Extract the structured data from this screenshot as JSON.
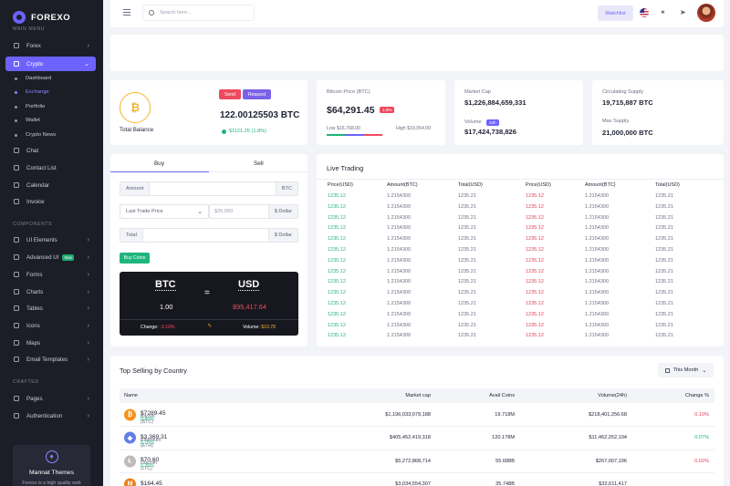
{
  "brand": "FOREXO",
  "sidebar": {
    "main_menu": "MAIN MENU",
    "components": "COMPONENTS",
    "crafted": "CRAFTED",
    "items": [
      {
        "label": "Forex"
      },
      {
        "label": "Crypto"
      },
      {
        "label": "Chat"
      },
      {
        "label": "Contact List"
      },
      {
        "label": "Calendar"
      },
      {
        "label": "Invoice"
      },
      {
        "label": "UI Elements"
      },
      {
        "label": "Advanced UI"
      },
      {
        "label": "Forms"
      },
      {
        "label": "Charts"
      },
      {
        "label": "Tables"
      },
      {
        "label": "Icons"
      },
      {
        "label": "Maps"
      },
      {
        "label": "Email Templates"
      },
      {
        "label": "Pages"
      },
      {
        "label": "Authentication"
      }
    ],
    "crypto_sub": [
      "Dashboard",
      "Exchange",
      "Portfolio",
      "Wallet",
      "Crypto News"
    ],
    "new_badge": "New",
    "promo_title": "Mannat Themes",
    "promo_desc": "Forexo is a high quality web"
  },
  "topbar": {
    "search_placeholder": "Search here...",
    "watchlist": "Watchlist"
  },
  "balance": {
    "coin": "₿",
    "label": "Total Balance",
    "send": "Send",
    "request": "Request",
    "amount": "122.00125503 BTC",
    "usd": "$1121.25 (1.8%)"
  },
  "btc_price": {
    "label": "Bitcoin Price (BTC)",
    "value": "$64,291.45",
    "change": "1.8%",
    "low": "Low $16,768.00",
    "high": "High $19,054.00"
  },
  "market": {
    "cap_label": "Market Cap",
    "cap": "$1,226,884,659,331",
    "volume_label": "Volume",
    "volume_badge": "24h",
    "volume": "$17,424,738,826"
  },
  "supply": {
    "circ_label": "Circulating Supply",
    "circ": "19,715,887 BTC",
    "max_label": "Max Supply",
    "max": "21,000,000 BTC"
  },
  "trade": {
    "tab_buy": "Buy",
    "tab_sell": "Sell",
    "amount_label": "Amount",
    "amount_unit": "BTC",
    "order_type": "Last Trade Price",
    "price_placeholder": "$25,000",
    "price_unit": "$ Dollar",
    "total_label": "Total",
    "total_unit": "$ Dollar",
    "buy_button": "Buy Coins",
    "from": "BTC",
    "to": "USD",
    "from_val": "1.00",
    "to_val": "$95,417.64",
    "change_label": "Change:",
    "change": "-3.19%",
    "volume_label": "Volume:",
    "volume": "$10.78"
  },
  "live": {
    "title": "Live Trading",
    "headers": [
      "Price(USD)",
      "Amount(BTC)",
      "Total(USD)",
      "Price(USD)",
      "Amount(BTC)",
      "Total(USD)"
    ],
    "price": "1235.12",
    "amount": "1.2154300",
    "total": "1235.21"
  },
  "top": {
    "title": "Top Selling by Country",
    "filter": "This Month",
    "headers": [
      "Name",
      "Market cap",
      "Avail Coins",
      "Volume(24h)",
      "Change %"
    ],
    "rows": [
      {
        "price": "$7289.45",
        "name": "Bitcoin (BTC)",
        "pct": "0.45%",
        "cap": "$1,196,033,079,188",
        "coins": "19.718M",
        "vol": "$218,401,256.68",
        "change": "0.10%",
        "color": "#f7931a",
        "sym": "₿"
      },
      {
        "price": "$3,369.31",
        "name": "Ethereum (ETH)",
        "pct": "0.75%",
        "cap": "$405,452,419,318",
        "coins": "120.178M",
        "vol": "$11,462,252,104",
        "change": "0.07%",
        "color": "#627eea",
        "sym": "◆"
      },
      {
        "price": "$70.60",
        "name": "Litecoin (LTC)",
        "pct": "0.35%",
        "cap": "$5,272,868,714",
        "coins": "55.688B",
        "vol": "$267,007,196",
        "change": "0.02%",
        "color": "#bfbbbb",
        "sym": "Ł"
      },
      {
        "price": "$164.45",
        "name": "",
        "pct": "",
        "cap": "$3,034,554,307",
        "coins": "35.748B",
        "vol": "$32,611,417",
        "change": "",
        "color": "#e8831e",
        "sym": "M"
      }
    ]
  }
}
